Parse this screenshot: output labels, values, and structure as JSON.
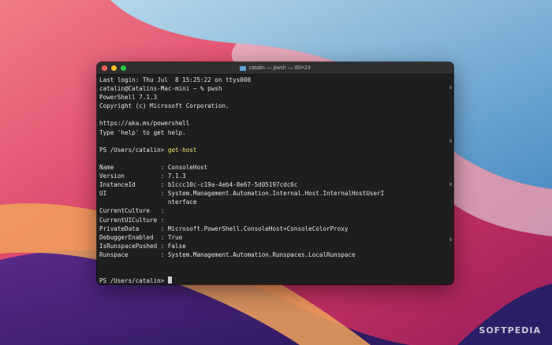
{
  "window": {
    "title": "catalin — pwsh — 80×24",
    "folder_icon": "folder-icon"
  },
  "terminal": {
    "lines": [
      {
        "t": "Last login: Thu Jul  8 15:25:22 on ttys000"
      },
      {
        "t": "catalin@Catalins-Mac-mini ~ % pwsh"
      },
      {
        "t": "PowerShell 7.1.3"
      },
      {
        "t": "Copyright (c) Microsoft Corporation."
      },
      {
        "t": ""
      },
      {
        "t": "https://aka.ms/powershell"
      },
      {
        "t": "Type 'help' to get help."
      },
      {
        "t": ""
      },
      {
        "t": "PS /Users/catalin> ",
        "cmd": "get-host"
      },
      {
        "t": ""
      },
      {
        "t": "Name             : ConsoleHost"
      },
      {
        "t": "Version          : 7.1.3"
      },
      {
        "t": "InstanceId       : b1ccc10c-c19a-4eb4-8e67-5d05197cdc6c"
      },
      {
        "t": "UI               : System.Management.Automation.Internal.Host.InternalHostUserI"
      },
      {
        "t": "                   nterface"
      },
      {
        "t": "CurrentCulture   :"
      },
      {
        "t": "CurrentUICulture :"
      },
      {
        "t": "PrivateData      : Microsoft.PowerShell.ConsoleHost+ConsoleColorProxy"
      },
      {
        "t": "DebuggerEnabled  : True"
      },
      {
        "t": "IsRunspacePushed : False"
      },
      {
        "t": "Runspace         : System.Management.Automation.Runspaces.LocalRunspace"
      },
      {
        "t": ""
      },
      {
        "t": ""
      },
      {
        "t": "PS /Users/catalin> ",
        "cursor": true
      }
    ],
    "colors": {
      "background": "#1e1e1e",
      "text": "#e6e6e6",
      "command": "#f2e86a"
    }
  },
  "watermark": "SOFTPEDIA"
}
